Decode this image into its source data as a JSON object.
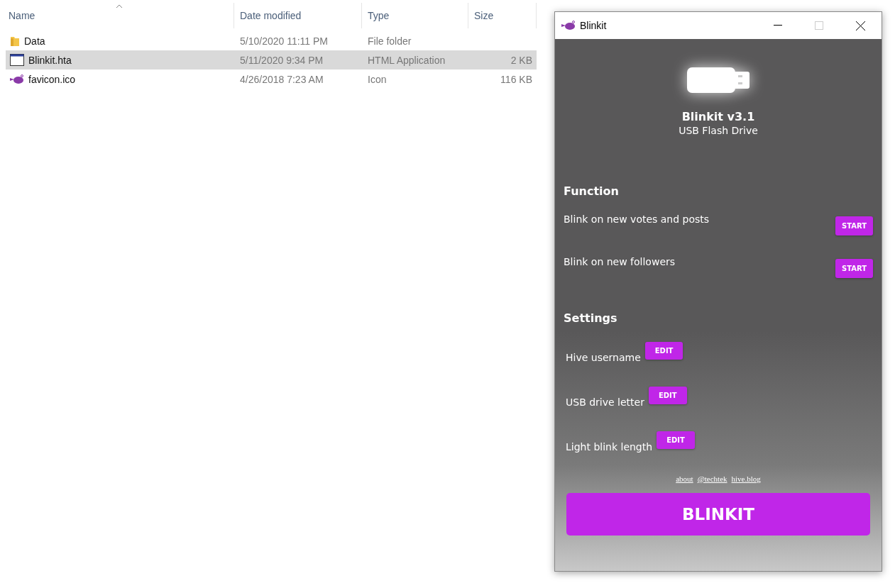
{
  "explorer": {
    "columns": [
      "Name",
      "Date modified",
      "Type",
      "Size"
    ],
    "rows": [
      {
        "kind": "folder",
        "name": "Data",
        "date": "5/10/2020 11:11 PM",
        "type": "File folder",
        "selected": false
      },
      {
        "kind": "app",
        "name": "Blinkit.hta",
        "date": "5/11/2020 9:34 PM",
        "type": "HTML Application",
        "size": "2 KB",
        "selected": true
      },
      {
        "kind": "icon",
        "name": "favicon.ico",
        "date": "4/26/2018 7:23 AM",
        "type": "Icon",
        "size": "116 KB",
        "selected": false
      }
    ]
  },
  "window": {
    "title": "Blinkit"
  },
  "app": {
    "title": "Blinkit v3.1",
    "subtitle": "USB Flash Drive",
    "function_heading": "Function",
    "functions": [
      {
        "label": "Blink on new votes and posts",
        "button": "START"
      },
      {
        "label": "Blink on new followers",
        "button": "START"
      }
    ],
    "settings_heading": "Settings",
    "settings": [
      {
        "label": "Hive username",
        "button": "EDIT"
      },
      {
        "label": "USB drive letter",
        "button": "EDIT"
      },
      {
        "label": "Light blink length",
        "button": "EDIT"
      }
    ],
    "links": [
      "about",
      "@techtek",
      "hive.blog"
    ],
    "main_button": "BLINKIT"
  }
}
